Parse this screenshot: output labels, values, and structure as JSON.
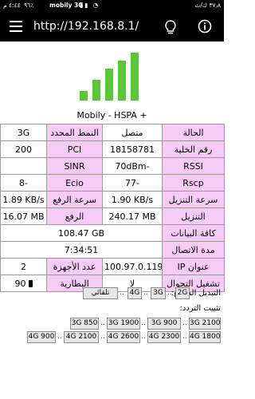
{
  "status_bar": {
    "time": "٤:٤٤ م",
    "battery": "٩٦٪",
    "carrier": "mobily 3G",
    "speed": "٣٧٫٨ ك/ث"
  },
  "app_bar": {
    "url": "http://192.168.8.1/",
    "icons": [
      "menu-icon",
      "lightbulb-icon",
      "info-icon"
    ]
  },
  "signal": {
    "bars": 5,
    "color": "#5ac735"
  },
  "operator": "Mobily - HSPA +",
  "table": {
    "status_label": "الحالة",
    "status_value": "متصل",
    "mode_label": "النمط المحدد",
    "mode_value": "3G",
    "cell_label": "رقم الخلية",
    "cell_value": "18158781",
    "pci_label": "PCI",
    "pci_value": "200",
    "rssi_label": "RSSI",
    "rssi_value": "-70dBm",
    "sinr_label": "SINR",
    "sinr_value": "",
    "rscp_label": "Rscp",
    "rscp_value": "-77",
    "ecio_label": "Ecio",
    "ecio_value": "-8",
    "dl_speed_label": "سرعة التنزيل",
    "dl_speed_value": "1.90 KB/s",
    "ul_speed_label": "سرعة الرفع",
    "ul_speed_value": "1.89 KB/s",
    "dl_total_label": "التنزيل",
    "dl_total_value": "240.17 MB",
    "ul_total_label": "الرفع",
    "ul_total_value": "16.07 MB",
    "total_data_label": "كافة البيانات",
    "total_data_value": "108.47 GB",
    "duration_label": "مدة الاتصال",
    "duration_value": "7:34:51",
    "ip_label": "عنوان IP",
    "ip_value": "100.97.0.119",
    "devices_label": "عدد الأجهزة",
    "devices_value": "2",
    "roaming_label": "تشغيل التجوال",
    "roaming_value": "لا",
    "battery_label": "البطارية",
    "battery_value": "90"
  },
  "quick_switch": {
    "label": "التبديل السريع:",
    "buttons": [
      "تلقائي",
      "4G",
      "3G",
      "2G"
    ]
  },
  "freq_lock": {
    "label": "تثبيت التردد:",
    "row1": [
      "3G 850",
      "3G 1900",
      "3G 900",
      "3G 2100"
    ],
    "row2": [
      "4G 900",
      "4G 2100",
      "4G 2600",
      "4G 2300",
      "4G 1800"
    ]
  }
}
